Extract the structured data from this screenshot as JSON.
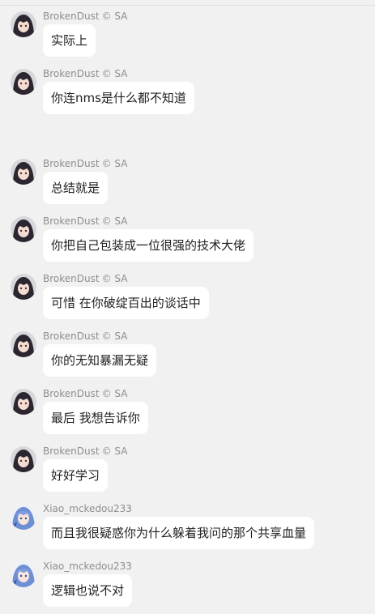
{
  "messages": [
    {
      "sender": "BrokenDust",
      "tag": "© SA",
      "text": "实际上",
      "avatar": "dark-hair-girl-avatar"
    },
    {
      "sender": "BrokenDust",
      "tag": "© SA",
      "text": "你连nms是什么都不知道",
      "avatar": "dark-hair-girl-avatar"
    },
    {
      "sender": "BrokenDust",
      "tag": "© SA",
      "text": "总结就是",
      "avatar": "dark-hair-girl-avatar"
    },
    {
      "sender": "BrokenDust",
      "tag": "© SA",
      "text": "你把自己包装成一位很强的技术大佬",
      "avatar": "dark-hair-girl-avatar"
    },
    {
      "sender": "BrokenDust",
      "tag": "© SA",
      "text": "可惜 在你破绽百出的谈话中",
      "avatar": "dark-hair-girl-avatar"
    },
    {
      "sender": "BrokenDust",
      "tag": "© SA",
      "text": "你的无知暴漏无疑",
      "avatar": "dark-hair-girl-avatar"
    },
    {
      "sender": "BrokenDust",
      "tag": "© SA",
      "text": "最后 我想告诉你",
      "avatar": "dark-hair-girl-avatar"
    },
    {
      "sender": "BrokenDust",
      "tag": "© SA",
      "text": "好好学习",
      "avatar": "dark-hair-girl-avatar"
    },
    {
      "sender": "Xiao_mckedou233",
      "tag": "",
      "text": "而且我很疑惑你为什么躲着我问的那个共享血量",
      "avatar": "blue-hair-girl-avatar"
    },
    {
      "sender": "Xiao_mckedou233",
      "tag": "",
      "text": "逻辑也说不对",
      "avatar": "blue-hair-girl-avatar"
    }
  ],
  "colors": {
    "background": "#f1f1f1",
    "bubble": "#ffffff",
    "name": "#8e8e8e",
    "text": "#1f1f1f"
  }
}
